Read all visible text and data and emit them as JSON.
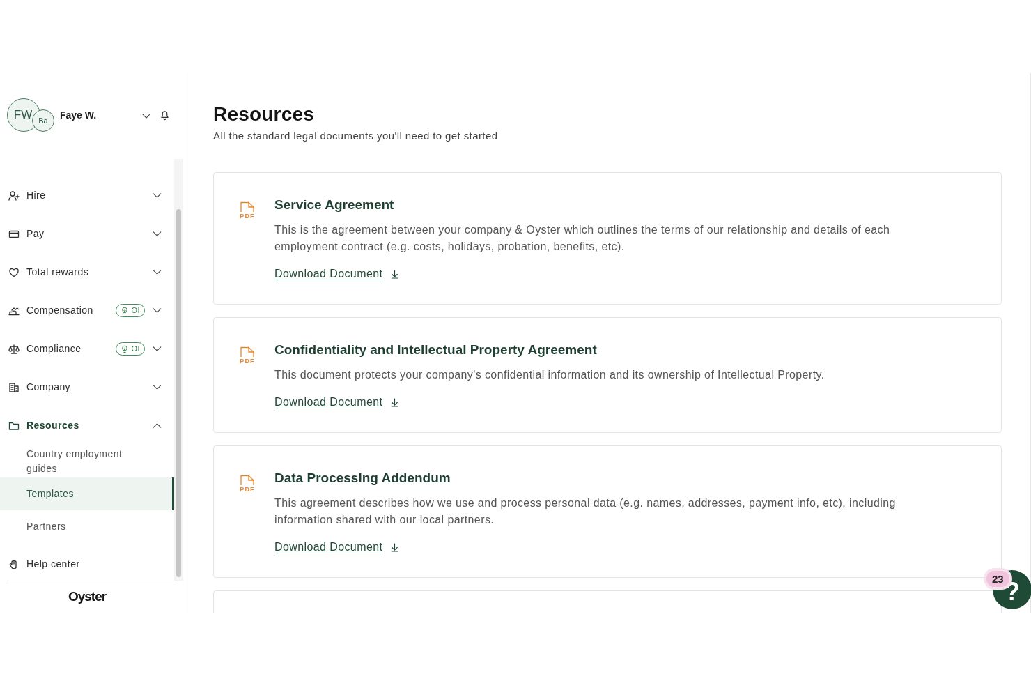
{
  "sidebar": {
    "user": {
      "initials": "FW",
      "company_initials": "Ba",
      "name": "Faye W."
    },
    "nav_items": [
      {
        "kind": "group",
        "label": "Hire",
        "selected": false,
        "expanded": false
      },
      {
        "kind": "group",
        "label": "Pay",
        "selected": false,
        "expanded": false
      },
      {
        "kind": "group",
        "label": "Total rewards",
        "selected": false,
        "expanded": false
      },
      {
        "kind": "group",
        "label": "Compensation",
        "selected": false,
        "expanded": false,
        "badge": "OI"
      },
      {
        "kind": "group",
        "label": "Compliance",
        "selected": false,
        "expanded": false,
        "badge": "OI"
      },
      {
        "kind": "group",
        "label": "Company",
        "selected": false,
        "expanded": false
      },
      {
        "kind": "group",
        "label": "Resources",
        "selected": true,
        "expanded": true,
        "children": [
          {
            "label": "Country employment guides",
            "selected": false
          },
          {
            "label": "Templates",
            "selected": true
          },
          {
            "label": "Partners",
            "selected": false
          }
        ]
      },
      {
        "kind": "link",
        "label": "Help center",
        "selected": false
      }
    ],
    "logo": "Oyster"
  },
  "page": {
    "title": "Resources",
    "subtitle": "All the standard legal documents you'll need to get started"
  },
  "documents": [
    {
      "file_type": "PDF",
      "title": "Service Agreement",
      "description": "This is the agreement between your company & Oyster which outlines the terms of our relationship and details of each employment contract (e.g. costs, holidays, probation, benefits, etc).",
      "link": "Download Document"
    },
    {
      "file_type": "PDF",
      "title": "Confidentiality and Intellectual Property Agreement",
      "description": "This document protects your company's confidential information and its ownership of Intellectual Property.",
      "link": "Download Document"
    },
    {
      "file_type": "PDF",
      "title": "Data Processing Addendum",
      "description": "This agreement describes how we use and process personal data (e.g. names, addresses, payment info, etc), including information shared with our local partners.",
      "link": "Download Document"
    }
  ],
  "help_widget": {
    "label": "?",
    "badge": "23"
  }
}
